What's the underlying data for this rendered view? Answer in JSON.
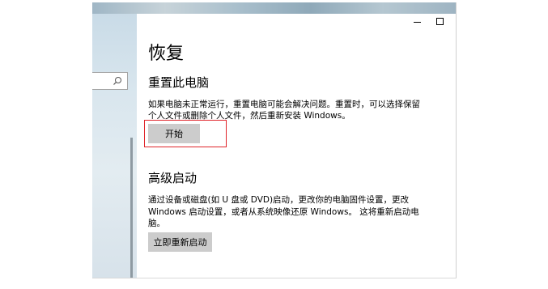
{
  "window": {
    "minimize_label": "",
    "maximize_label": ""
  },
  "page": {
    "title": "恢复"
  },
  "reset": {
    "title": "重置此电脑",
    "desc_line1": "如果电脑未正常运行，重置电脑可能会解决问题。重置时，可以选择保留",
    "desc_line2": "个人文件或删除个人文件，然后重新安装 Windows。",
    "button_label": "开始"
  },
  "advanced": {
    "title": "高级启动",
    "desc_line1": "通过设备或磁盘(如 U 盘或 DVD)启动，更改你的电脑固件设置，更改",
    "desc_line2": "Windows 启动设置，或者从系统映像还原 Windows。 这将重新启动电",
    "desc_line3": "脑。",
    "button_label": "立即重新启动"
  },
  "icons": {
    "search": "search-icon",
    "minimize": "minimize-icon",
    "maximize": "maximize-icon"
  },
  "colors": {
    "highlight_border": "#e0242a",
    "button_bg": "#cccccc"
  }
}
